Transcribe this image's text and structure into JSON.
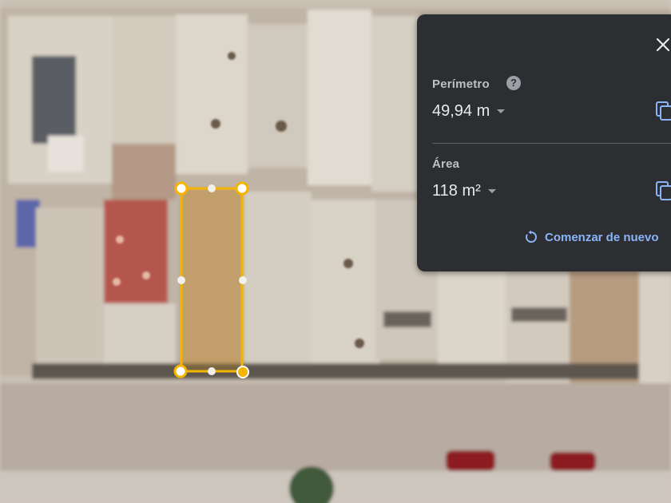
{
  "map": {
    "view": "satellite",
    "polygon_color": "#f4b400"
  },
  "panel": {
    "perimeter_label": "Perímetro",
    "perimeter_value": "49,94 m",
    "area_label": "Área",
    "area_value": "118 m²",
    "restart_label": "Comenzar de nuevo",
    "help_icon_text": "?",
    "accent_color": "#8ab4f8",
    "icons": [
      "close-icon",
      "help-icon",
      "copy-icon",
      "restart-icon",
      "caret-down-icon"
    ]
  }
}
